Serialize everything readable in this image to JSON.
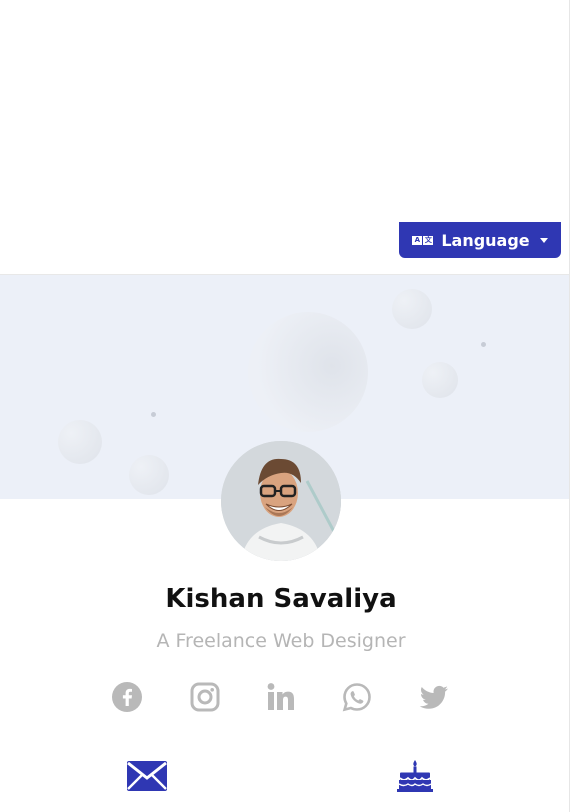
{
  "language_button": {
    "label": "Language"
  },
  "profile": {
    "name": "Kishan Savaliya",
    "tagline": "A Freelance Web Designer"
  },
  "social_icons": [
    "facebook-icon",
    "instagram-icon",
    "linkedin-icon",
    "whatsapp-icon",
    "twitter-icon"
  ],
  "contact_icons": [
    "mail-icon",
    "birthday-cake-icon"
  ],
  "colors": {
    "accent": "#2f37b3",
    "cover_background": "#ecf0f8",
    "social_icon": "#b9b9b9",
    "tagline": "#b5b5b5",
    "name": "#111111"
  }
}
